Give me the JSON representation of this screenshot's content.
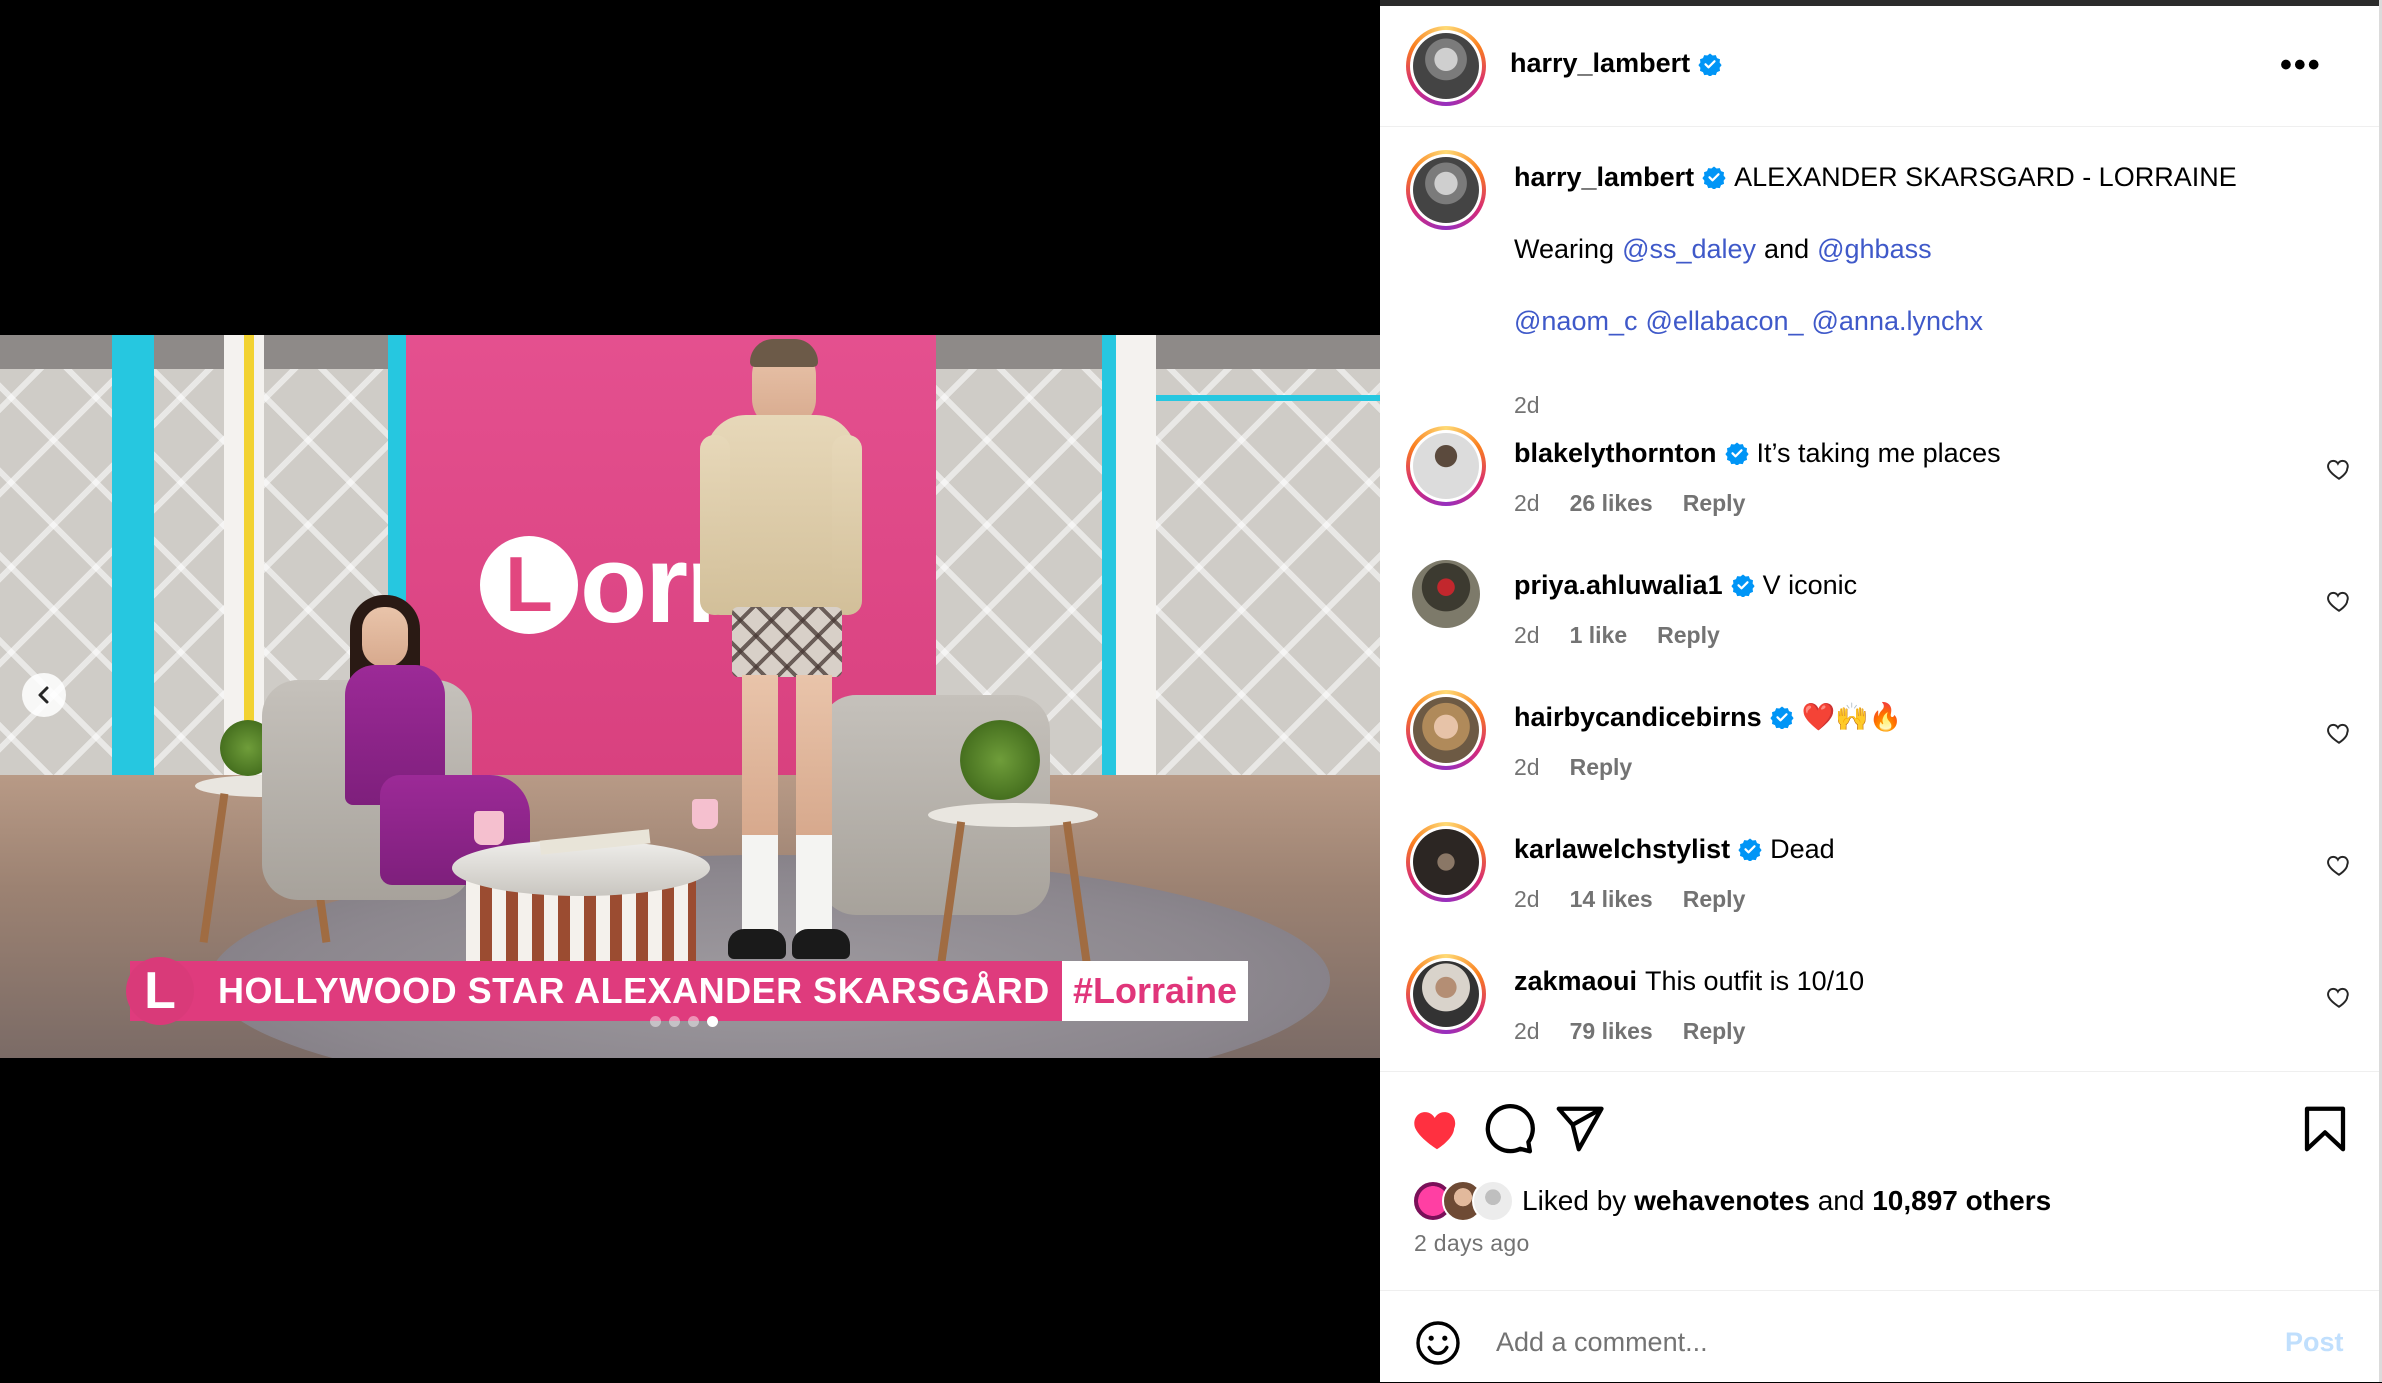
{
  "post": {
    "author": "harry_lambert",
    "caption_title": "ALEXANDER SKARSGARD - LORRAINE",
    "caption_wearing_prefix": "Wearing",
    "caption_tag1": "@ss_daley",
    "caption_and": "and",
    "caption_tag2": "@ghbass",
    "caption_mentions": [
      "@naom_c",
      "@ellabacon_",
      "@anna.lynchx"
    ],
    "caption_time": "2d"
  },
  "media": {
    "logo_letter": "L",
    "logo_text": "orra",
    "lower_third_badge": "L",
    "lower_third_text": "HOLLYWOOD STAR ALEXANDER SKARSGÅRD",
    "lower_third_tag": "#Lorraine",
    "carousel_dots": 4,
    "carousel_active": 4
  },
  "comments": [
    {
      "user": "blakelythornton",
      "verified": true,
      "text": "It’s taking me places",
      "time": "2d",
      "likes": "26 likes",
      "reply": "Reply",
      "ring": true
    },
    {
      "user": "priya.ahluwalia1",
      "verified": true,
      "text": "V iconic",
      "time": "2d",
      "likes": "1 like",
      "reply": "Reply",
      "ring": false
    },
    {
      "user": "hairbycandicebirns",
      "verified": true,
      "text": "❤️🙌🔥",
      "time": "2d",
      "likes": "",
      "reply": "Reply",
      "ring": true
    },
    {
      "user": "karlawelchstylist",
      "verified": true,
      "text": "Dead",
      "time": "2d",
      "likes": "14 likes",
      "reply": "Reply",
      "ring": true
    },
    {
      "user": "zakmaoui",
      "verified": false,
      "text": "This outfit is 10/10",
      "time": "2d",
      "likes": "79 likes",
      "reply": "Reply",
      "ring": true
    }
  ],
  "likes": {
    "liked_by_prefix": "Liked by",
    "liked_by_user": "wehavenotes",
    "and": "and",
    "others": "10,897 others",
    "time": "2 days ago"
  },
  "composer": {
    "placeholder": "Add a comment...",
    "post_label": "Post"
  },
  "header": {
    "more_label": "•••"
  },
  "icons": {
    "like": "heart-filled-icon",
    "comment": "comment-icon",
    "share": "send-icon",
    "save": "bookmark-icon",
    "emoji": "emoji-icon",
    "more": "more-icon",
    "prev": "chevron-left-icon"
  },
  "colors": {
    "like_red": "#ff3040",
    "link_blue": "#3f59c9",
    "verified_blue": "#0095f6",
    "lorraine_pink": "#df3b7d",
    "post_button_disabled": "#c0dffd"
  }
}
